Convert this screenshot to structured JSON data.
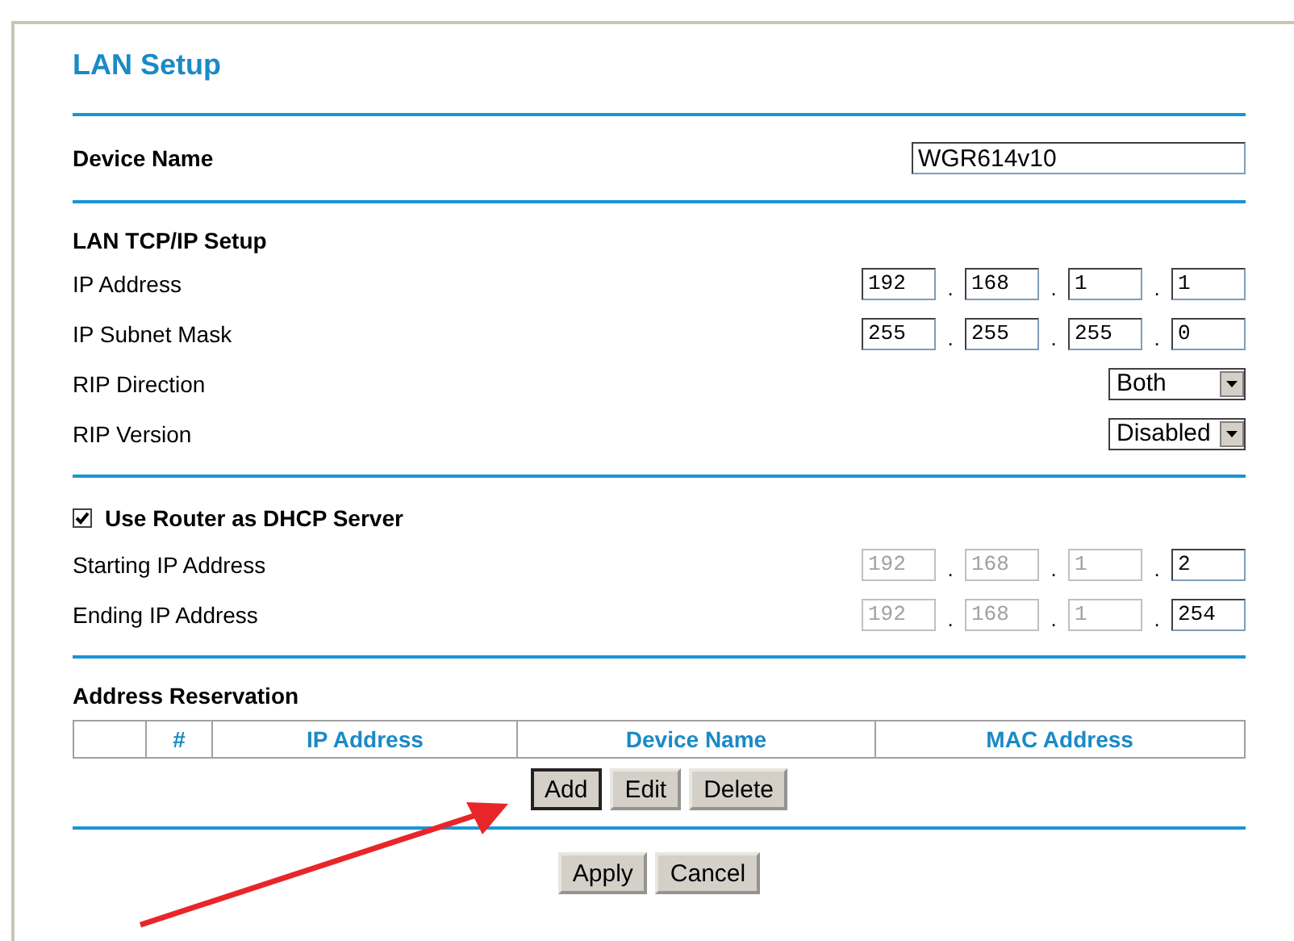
{
  "title": "LAN Setup",
  "device_name": {
    "label": "Device Name",
    "value": "WGR614v10"
  },
  "lan_tcpip": {
    "heading": "LAN TCP/IP Setup",
    "rows": [
      {
        "kind": "ip",
        "label": "IP Address",
        "separator": ".",
        "octets": [
          {
            "value": "192",
            "disabled": false
          },
          {
            "value": "168",
            "disabled": false
          },
          {
            "value": "1",
            "disabled": false
          },
          {
            "value": "1",
            "disabled": false
          }
        ]
      },
      {
        "kind": "ip",
        "label": "IP Subnet Mask",
        "separator": ".",
        "octets": [
          {
            "value": "255",
            "disabled": false
          },
          {
            "value": "255",
            "disabled": false
          },
          {
            "value": "255",
            "disabled": false
          },
          {
            "value": "0",
            "disabled": false
          }
        ]
      },
      {
        "kind": "select",
        "label": "RIP Direction",
        "value": "Both"
      },
      {
        "kind": "select",
        "label": "RIP Version",
        "value": "Disabled"
      }
    ]
  },
  "dhcp": {
    "label": "Use Router as DHCP Server",
    "checked": true,
    "rows": [
      {
        "kind": "ip",
        "label": "Starting IP Address",
        "separator": ".",
        "octets": [
          {
            "value": "192",
            "disabled": true
          },
          {
            "value": "168",
            "disabled": true
          },
          {
            "value": "1",
            "disabled": true
          },
          {
            "value": "2",
            "disabled": false
          }
        ]
      },
      {
        "kind": "ip",
        "label": "Ending IP Address",
        "separator": ".",
        "octets": [
          {
            "value": "192",
            "disabled": true
          },
          {
            "value": "168",
            "disabled": true
          },
          {
            "value": "1",
            "disabled": true
          },
          {
            "value": "254",
            "disabled": false
          }
        ]
      }
    ]
  },
  "reservation": {
    "heading": "Address Reservation",
    "columns": [
      "#",
      "IP Address",
      "Device Name",
      "MAC Address"
    ],
    "buttons": [
      "Add",
      "Edit",
      "Delete"
    ]
  },
  "buttons": [
    "Apply",
    "Cancel"
  ]
}
